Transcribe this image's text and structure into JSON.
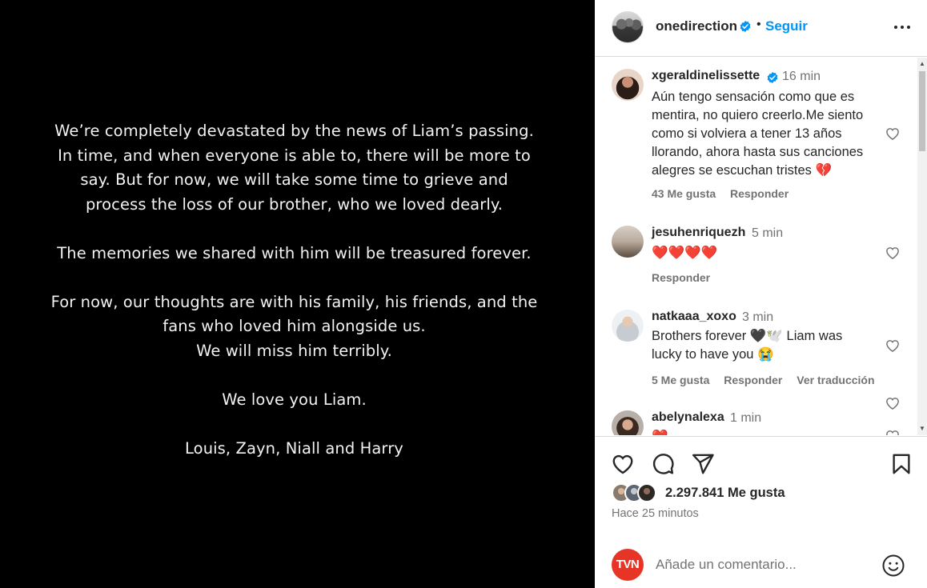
{
  "post": {
    "paragraphs": [
      [
        "We’re completely devastated by the news of Liam’s passing.",
        "In time, and when everyone is able to, there will be more to",
        "say. But for now, we will take some time to grieve and",
        "process the loss of our brother, who we loved dearly."
      ],
      [
        "The memories we shared with him will be treasured forever."
      ],
      [
        "For now, our thoughts are with his family, his friends, and the",
        "fans who loved him alongside us.",
        "We will miss him terribly."
      ],
      [
        "We love you Liam."
      ],
      [
        "Louis, Zayn, Niall and Harry"
      ]
    ]
  },
  "header": {
    "username": "onedirection",
    "separator": "•",
    "follow_label": "Seguir",
    "verified_icon": "verified-badge-icon",
    "more_icon": "more-options-icon"
  },
  "comments": [
    {
      "username": "xgeraldinelissette",
      "verified": true,
      "time": "16 min",
      "lines": [
        "Aún tengo sensación como que es",
        "mentira, no quiero creerlo.Me siento",
        "como si volviera a tener 13 años",
        "llorando, ahora hasta sus canciones",
        "alegres se escuchan tristes 💔"
      ],
      "likes": "43 Me gusta",
      "reply": "Responder"
    },
    {
      "username": "jesuhenriquezh",
      "verified": false,
      "time": "5 min",
      "lines": [
        "❤️❤️❤️❤️"
      ],
      "reply": "Responder"
    },
    {
      "username": "natkaaa_xoxo",
      "verified": false,
      "time": "3 min",
      "lines": [
        "Brothers forever 🖤🕊️ Liam was",
        "lucky to have you 😭"
      ],
      "likes": "5 Me gusta",
      "reply": "Responder",
      "translate": "Ver traducción"
    },
    {
      "username": "abelynalexa",
      "verified": false,
      "time": "1 min",
      "lines": [
        "❤️"
      ]
    }
  ],
  "actions": {
    "likes": "2.297.841 Me gusta",
    "time_ago": "Hace 25 minutos",
    "comment_placeholder": "Añade un comentario...",
    "commenter_avatar_text": "TVN",
    "icons": [
      "heart-icon",
      "comment-icon",
      "share-icon",
      "bookmark-icon",
      "emoji-icon"
    ]
  },
  "colors": {
    "accent": "#0095f6",
    "verified": "#0095f6",
    "muted": "#737373",
    "tvn": "#e63426"
  }
}
